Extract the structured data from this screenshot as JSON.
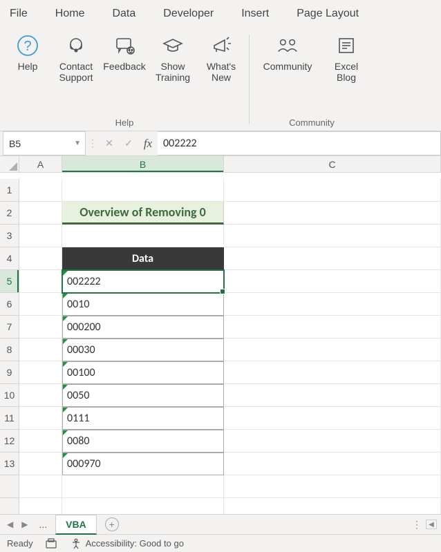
{
  "ribbon": {
    "tabs": [
      "File",
      "Home",
      "Data",
      "Developer",
      "Insert",
      "Page Layout"
    ],
    "groups": [
      {
        "label": "Help",
        "items": [
          {
            "icon": "help",
            "label": "Help"
          },
          {
            "icon": "headset",
            "label": "Contact Support"
          },
          {
            "icon": "feedback",
            "label": "Feedback"
          },
          {
            "icon": "training",
            "label": "Show Training"
          },
          {
            "icon": "megaphone",
            "label": "What's New"
          }
        ]
      },
      {
        "label": "Community",
        "items": [
          {
            "icon": "community",
            "label": "Community"
          },
          {
            "icon": "blog",
            "label": "Excel Blog"
          }
        ]
      }
    ]
  },
  "formula_bar": {
    "name_box": "B5",
    "formula_value": "002222"
  },
  "grid": {
    "columns": [
      "A",
      "B",
      "C"
    ],
    "rows": [
      1,
      2,
      3,
      4,
      5,
      6,
      7,
      8,
      9,
      10,
      11,
      12,
      13
    ],
    "selected_cell": "B5",
    "title": "Overview of Removing 0",
    "data_header": "Data",
    "data": [
      "002222",
      "0010",
      "000200",
      "00030",
      "00100",
      "0050",
      "0111",
      "0080",
      "000970"
    ]
  },
  "sheet_tabs": {
    "overflow": "...",
    "active": "VBA"
  },
  "status": {
    "state": "Ready",
    "accessibility": "Accessibility: Good to go"
  }
}
